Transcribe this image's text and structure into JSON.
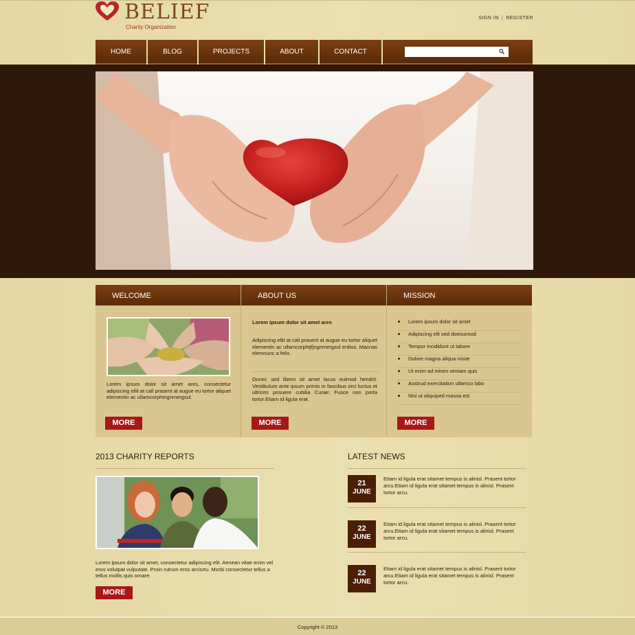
{
  "brand": {
    "name": "BELIEF",
    "tagline": "Charity Organization"
  },
  "auth": {
    "sign_in": "SIGN IN",
    "separator": "|",
    "register": "REGISTER"
  },
  "nav": {
    "items": [
      {
        "label": "HOME"
      },
      {
        "label": "BLOG"
      },
      {
        "label": "PROJECTS"
      },
      {
        "label": "ABOUT"
      },
      {
        "label": "CONTACT"
      }
    ],
    "search": {
      "placeholder": ""
    }
  },
  "welcome": {
    "title": "WELCOME",
    "text": "Lorem ipsum dolor sit amet ares, consectetur adipiscing ellit at call prasent at augue eu tortor aliquet elementin ac ullamcorphtngnmergsul.",
    "more": "MORE"
  },
  "about": {
    "title": "ABOUT US",
    "heading": "Lorem ipsum dolor sit amet ares",
    "text1": "Adipiscing ellit at cali prasent at augue eu tortor aliquet elementin ac ullamcorphtjfjngnmergsul erdios. Macnas elemnunc a felis.",
    "text2": "Donec sed libero sit amet lacus euimod hendrit. Vestibulum ante ipsum primis in faucibus orci luctus et ultrices posuere cubilia Curae; Fusce non porta tortor.Etiam id ligula erat.",
    "more": "MORE"
  },
  "mission": {
    "title": "MISSION",
    "items": [
      "Lorem ipsum dolor sit amet",
      "Adipiscing elit sed doeiusmod",
      "Tempor incididunt ut labore",
      "Dolore magna aliqua noste",
      "Ut enim ad minim veniam quis",
      "Aostrud exercitation ullamco labo",
      "Nisi ut aliquiped massa est"
    ],
    "more": "MORE"
  },
  "reports": {
    "title": "2013 CHARITY REPORTS",
    "text": "Lorem ipsum dolor sit amet, consectetur adipiscing elit. Aenean vitae enim vel eros volutpat vulputate. Proin rutrum eros arcisrtu. Morbi consectetur tellus a tellus mollis quis ornare.",
    "more": "MORE"
  },
  "news": {
    "title": "LATEST NEWS",
    "items": [
      {
        "day": "21",
        "month": "JUNE",
        "text": "Etiam id ligula erat sitamet tempus is alinisl. Prasent tortor arcu.Etiam id ligula erat sitamet tempus is alinisl. Prasent tortor arcu."
      },
      {
        "day": "22",
        "month": "JUNE",
        "text": "Etiam id ligula erat sitamet tempus is alinisl. Prasent tortor arcu.Etiam id ligula erat sitamet tempus is alinisl. Prasent tortor arcu."
      },
      {
        "day": "22",
        "month": "JUNE",
        "text": "Etiam id ligula erat sitamet tempus is alinisl. Prasent tortor arcu.Etiam id ligula erat sitamet tempus is alinisl. Prasent tortor arcu."
      }
    ]
  },
  "footer": {
    "copyright": "Copyright © 2013"
  },
  "colors": {
    "accent_brown": "#5a2a08",
    "button_red": "#a81818",
    "page_bg": "#e6d8a4"
  }
}
